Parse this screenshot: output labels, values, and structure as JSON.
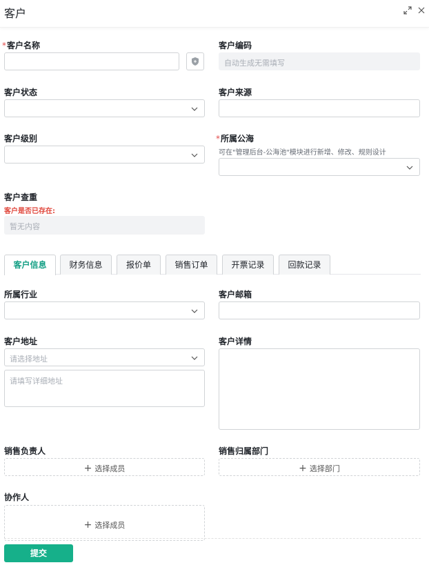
{
  "header": {
    "title": "客户",
    "expand_icon": "expand-icon",
    "close_icon": "close-icon"
  },
  "form": {
    "name": {
      "label": "客户名称",
      "required_mark": "*",
      "value": "",
      "action_icon": "shield-icon"
    },
    "code": {
      "label": "客户编码",
      "placeholder": "自动生成无需填写"
    },
    "status": {
      "label": "客户状态",
      "value": ""
    },
    "source": {
      "label": "客户来源",
      "value": ""
    },
    "level": {
      "label": "客户级别",
      "value": ""
    },
    "pool": {
      "label": "所属公海",
      "required_mark": "*",
      "hint": "可在\"管理后台-公海池\"模块进行新增、修改、规则设计",
      "value": ""
    },
    "dedupe": {
      "label": "客户查重",
      "warning": "客户是否已存在:",
      "empty_text": "暂无内容"
    }
  },
  "tabs": [
    {
      "label": "客户信息",
      "active": true
    },
    {
      "label": "财务信息",
      "active": false
    },
    {
      "label": "报价单",
      "active": false
    },
    {
      "label": "销售订单",
      "active": false
    },
    {
      "label": "开票记录",
      "active": false
    },
    {
      "label": "回款记录",
      "active": false
    }
  ],
  "detail": {
    "industry": {
      "label": "所属行业",
      "value": ""
    },
    "email": {
      "label": "客户邮箱",
      "value": ""
    },
    "address": {
      "label": "客户地址",
      "select_placeholder": "请选择地址",
      "detail_placeholder": "请填写详细地址"
    },
    "description": {
      "label": "客户详情",
      "value": ""
    },
    "sales_owner": {
      "label": "销售负责人",
      "button": "选择成员"
    },
    "sales_dept": {
      "label": "销售归属部门",
      "button": "选择部门"
    },
    "collaborator": {
      "label": "协作人",
      "button": "选择成员"
    }
  },
  "submit_label": "提交",
  "colors": {
    "accent": "#16b08a",
    "active_tab": "#16a086",
    "required": "#e34d4d",
    "warning": "#e0463b"
  }
}
